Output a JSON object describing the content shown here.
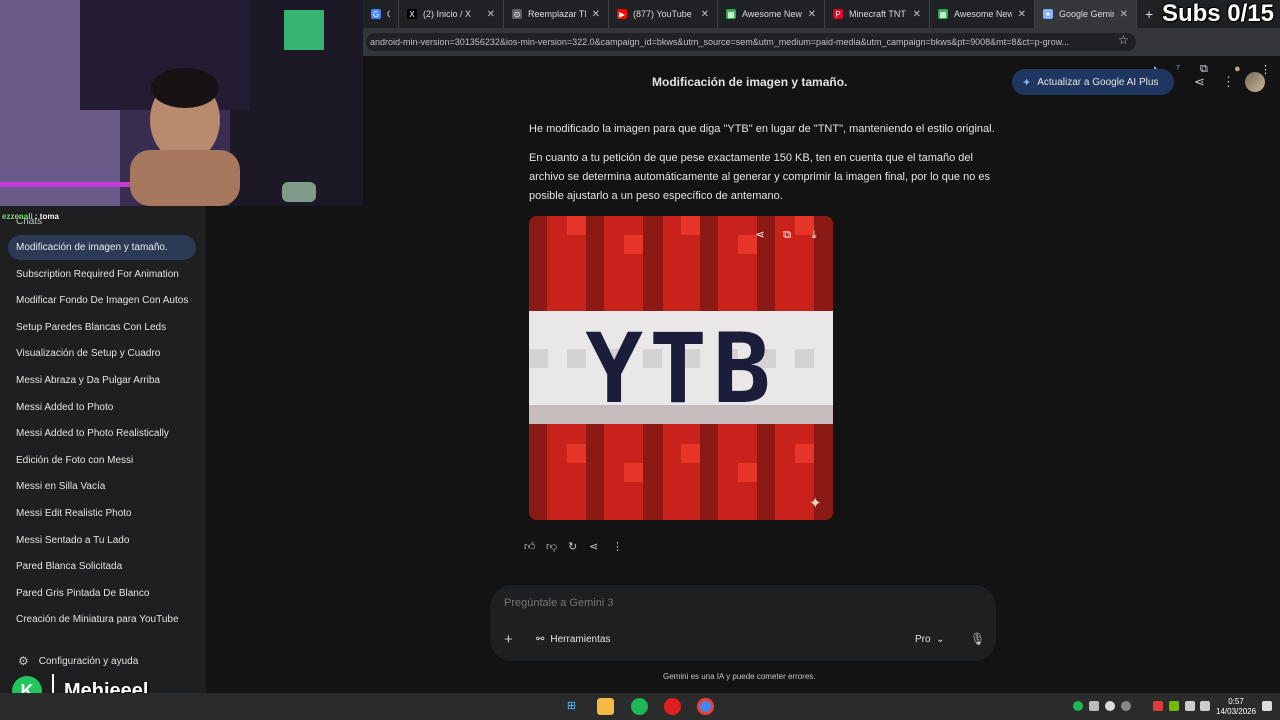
{
  "browser": {
    "tabs": [
      {
        "label": "Gi",
        "color": "#4285f4",
        "glyph": "G"
      },
      {
        "label": "(2) Inicio / X",
        "color": "#000000",
        "glyph": "X"
      },
      {
        "label": "Reemplazar TNT",
        "color": "#5f6368",
        "glyph": "⊙"
      },
      {
        "label": "(877) YouTube",
        "color": "#ff0000",
        "glyph": "▶"
      },
      {
        "label": "Awesome New",
        "color": "#34a853",
        "glyph": "▦"
      },
      {
        "label": "Minecraft TNT E",
        "color": "#e60023",
        "glyph": "P"
      },
      {
        "label": "Awesome New",
        "color": "#34a853",
        "glyph": "▦"
      },
      {
        "label": "Google Gemini",
        "color": "#8ab4f8",
        "glyph": "✦"
      }
    ],
    "new_tab": "+",
    "url": "android-min-version=301356232&ios-min-version=322.0&campaign_id=bkws&utm_source=sem&utm_medium=paid-media&utm_campaign=bkws&pt=9008&mt=8&ct=p-grow..."
  },
  "overlay": {
    "subs": "Subs 0/15",
    "chat_user": "ezzenali",
    "chat_message": ": toma",
    "brand_name": "Mehieeel",
    "brand_logo": "K"
  },
  "header": {
    "title": "Modificación de imagen y tamaño.",
    "upgrade": "Actualizar a Google AI Plus"
  },
  "sidebar": {
    "section": "Chats",
    "items": [
      "Modificación de imagen y tamaño.",
      "Subscription Required For Animation",
      "Modificar Fondo De Imagen Con Autos",
      "Setup Paredes Blancas Con Leds",
      "Visualización de Setup y Cuadro",
      "Messi Abraza y Da Pulgar Arriba",
      "Messi Added to Photo",
      "Messi Added to Photo Realistically",
      "Edición de Foto con Messi",
      "Messi en Silla Vacía",
      "Messi Edit Realistic Photo",
      "Messi Sentado a Tu Lado",
      "Pared Blanca Solicitada",
      "Pared Gris Pintada De Blanco",
      "Creación de Miniatura para YouTube"
    ],
    "settings": "Configuración y ayuda"
  },
  "response": {
    "p1": "He modificado la imagen para que diga \"YTB\" en lugar de \"TNT\", manteniendo el estilo original.",
    "p2": "En cuanto a tu petición de que pese exactamente 150 KB, ten en cuenta que el tamaño del archivo se determina automáticamente al generar y comprimir la imagen final, por lo que no es posible ajustarlo a un peso específico de antemano.",
    "image_text": "YTB"
  },
  "prompt": {
    "placeholder": "Pregúntale a Gemini 3",
    "tools": "Herramientas",
    "model": "Pro",
    "disclaimer": "Gemini es una IA y puede cometer errores."
  },
  "taskbar": {
    "time": "0:57",
    "date": "14/03/2026"
  },
  "colors": {
    "tnt_red": "#c8221b",
    "tnt_dark": "#8b1a14",
    "tnt_white": "#e9e7e8",
    "tnt_letters": "#1c1d3b",
    "accent": "#8ab4f8"
  }
}
